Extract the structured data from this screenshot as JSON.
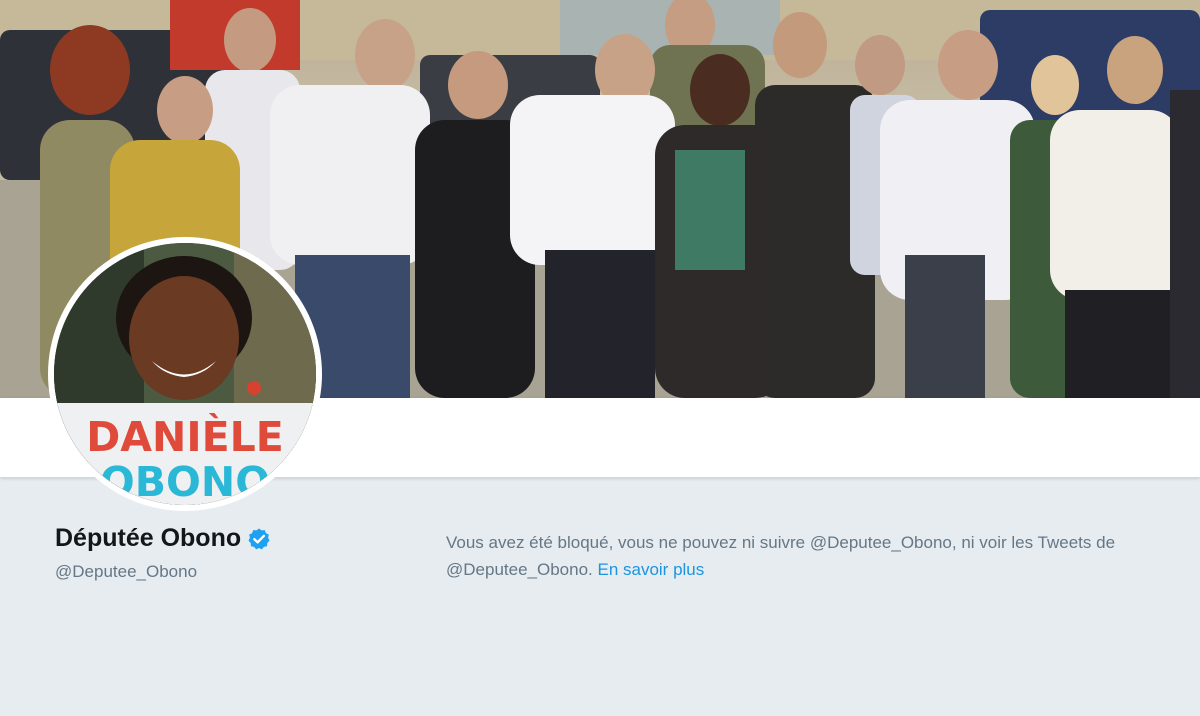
{
  "profile": {
    "display_name": "Députée Obono",
    "handle": "@Deputee_Obono",
    "verified": true,
    "avatar_text_line1": "DANIÈLE",
    "avatar_text_line2": "OBONO"
  },
  "blocked_notice": {
    "message": "Vous avez été bloqué, vous ne pouvez ni suivre @Deputee_Obono, ni voir les Tweets de @Deputee_Obono.",
    "link_label": "En savoir plus"
  },
  "icons": {
    "verified": "verified-badge-icon"
  },
  "colors": {
    "link": "#1b95e0",
    "verified": "#1da1f2",
    "secondary_text": "#657786",
    "background": "#e6ecf0",
    "avatar_red": "#e04a3a",
    "avatar_blue": "#2bb7d6"
  }
}
